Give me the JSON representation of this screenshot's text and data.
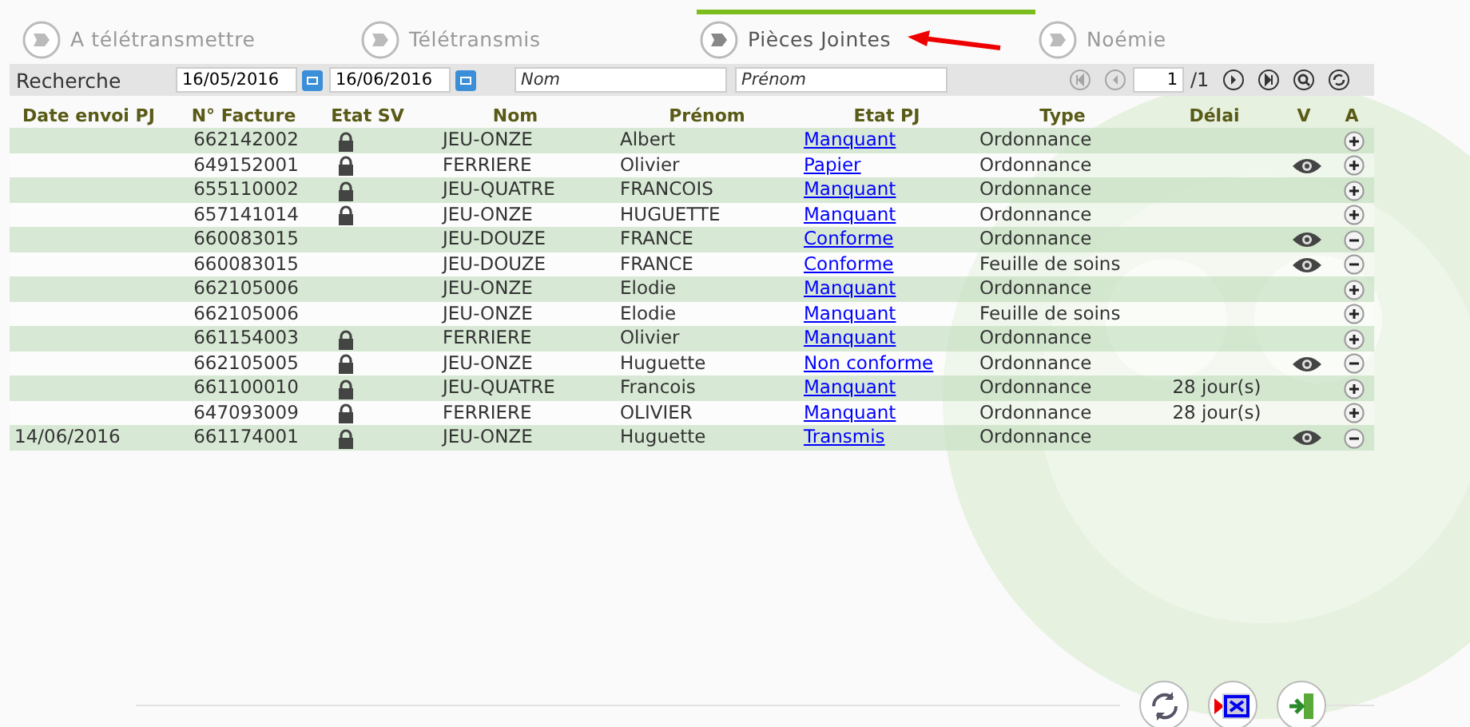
{
  "tabs": [
    {
      "label": "A télétransmettre",
      "selected": false
    },
    {
      "label": "Télétransmis",
      "selected": false
    },
    {
      "label": "Pièces Jointes",
      "selected": true
    },
    {
      "label": "Noémie",
      "selected": false
    }
  ],
  "search": {
    "label": "Recherche",
    "date_from": "16/05/2016",
    "date_to": "16/06/2016",
    "nom_placeholder": "Nom",
    "prenom_placeholder": "Prénom",
    "page": "1",
    "page_total": "/1"
  },
  "table": {
    "columns": [
      "Date envoi PJ",
      "N° Facture",
      "Etat SV",
      "Nom",
      "Prénom",
      "Etat PJ",
      "Type",
      "Délai",
      "V",
      "A"
    ],
    "rows": [
      {
        "date": "",
        "facture": "662142002",
        "locked": true,
        "nom": "JEU-ONZE",
        "prenom": "Albert",
        "etat_pj": "Manquant",
        "type": "Ordonnance",
        "delai": "",
        "viewable": false,
        "has_attachment": false
      },
      {
        "date": "",
        "facture": "649152001",
        "locked": true,
        "nom": "FERRIERE",
        "prenom": "Olivier",
        "etat_pj": "Papier",
        "type": "Ordonnance",
        "delai": "",
        "viewable": true,
        "has_attachment": false
      },
      {
        "date": "",
        "facture": "655110002",
        "locked": true,
        "nom": "JEU-QUATRE",
        "prenom": "FRANCOIS",
        "etat_pj": "Manquant",
        "type": "Ordonnance",
        "delai": "",
        "viewable": false,
        "has_attachment": false
      },
      {
        "date": "",
        "facture": "657141014",
        "locked": true,
        "nom": "JEU-ONZE",
        "prenom": "HUGUETTE",
        "etat_pj": "Manquant",
        "type": "Ordonnance",
        "delai": "",
        "viewable": false,
        "has_attachment": false
      },
      {
        "date": "",
        "facture": "660083015",
        "locked": false,
        "nom": "JEU-DOUZE",
        "prenom": "FRANCE",
        "etat_pj": "Conforme",
        "type": "Ordonnance",
        "delai": "",
        "viewable": true,
        "has_attachment": true
      },
      {
        "date": "",
        "facture": "660083015",
        "locked": false,
        "nom": "JEU-DOUZE",
        "prenom": "FRANCE",
        "etat_pj": "Conforme",
        "type": "Feuille de soins",
        "delai": "",
        "viewable": true,
        "has_attachment": true
      },
      {
        "date": "",
        "facture": "662105006",
        "locked": false,
        "nom": "JEU-ONZE",
        "prenom": "Elodie",
        "etat_pj": "Manquant",
        "type": "Ordonnance",
        "delai": "",
        "viewable": false,
        "has_attachment": false
      },
      {
        "date": "",
        "facture": "662105006",
        "locked": false,
        "nom": "JEU-ONZE",
        "prenom": "Elodie",
        "etat_pj": "Manquant",
        "type": "Feuille de soins",
        "delai": "",
        "viewable": false,
        "has_attachment": false
      },
      {
        "date": "",
        "facture": "661154003",
        "locked": true,
        "nom": "FERRIERE",
        "prenom": "Olivier",
        "etat_pj": "Manquant",
        "type": "Ordonnance",
        "delai": "",
        "viewable": false,
        "has_attachment": false
      },
      {
        "date": "",
        "facture": "662105005",
        "locked": true,
        "nom": "JEU-ONZE",
        "prenom": "Huguette",
        "etat_pj": "Non conforme",
        "type": "Ordonnance",
        "delai": "",
        "viewable": true,
        "has_attachment": true
      },
      {
        "date": "",
        "facture": "661100010",
        "locked": true,
        "nom": "JEU-QUATRE",
        "prenom": "Francois",
        "etat_pj": "Manquant",
        "type": "Ordonnance",
        "delai": "28 jour(s)",
        "viewable": false,
        "has_attachment": false
      },
      {
        "date": "",
        "facture": "647093009",
        "locked": true,
        "nom": "FERRIERE",
        "prenom": "OLIVIER",
        "etat_pj": "Manquant",
        "type": "Ordonnance",
        "delai": "28 jour(s)",
        "viewable": false,
        "has_attachment": false
      },
      {
        "date": "14/06/2016",
        "facture": "661174001",
        "locked": true,
        "nom": "JEU-ONZE",
        "prenom": "Huguette",
        "etat_pj": "Transmis",
        "type": "Ordonnance",
        "delai": "",
        "viewable": true,
        "has_attachment": true
      }
    ]
  }
}
